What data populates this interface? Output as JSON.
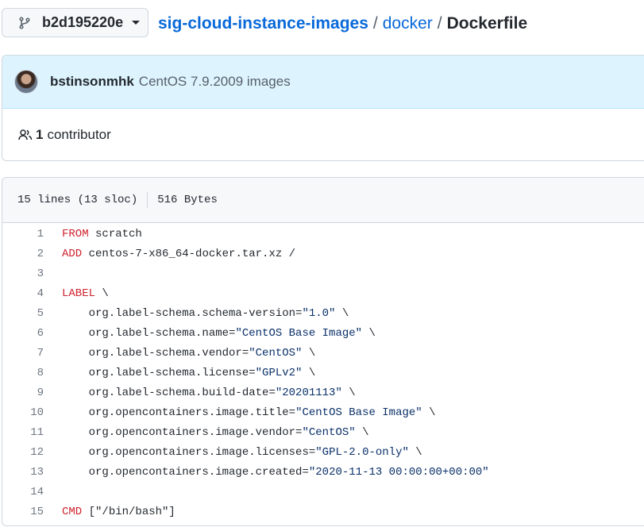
{
  "branch": {
    "name": "b2d195220e"
  },
  "breadcrumb": {
    "repo": "sig-cloud-instance-images",
    "sep1": "/",
    "dir": "docker",
    "sep2": "/",
    "file": "Dockerfile"
  },
  "commit": {
    "author": "bstinsonmhk",
    "message": "CentOS 7.9.2009 images"
  },
  "contributors": {
    "count": "1",
    "label": "contributor"
  },
  "file_info": {
    "lines": "15 lines (13 sloc)",
    "size": "516 Bytes"
  },
  "code": [
    {
      "n": "1",
      "parts": [
        {
          "t": "FROM",
          "c": "kw"
        },
        {
          "t": " scratch",
          "c": ""
        }
      ]
    },
    {
      "n": "2",
      "parts": [
        {
          "t": "ADD",
          "c": "kw"
        },
        {
          "t": " centos-7-x86_64-docker.tar.xz /",
          "c": ""
        }
      ]
    },
    {
      "n": "3",
      "parts": []
    },
    {
      "n": "4",
      "parts": [
        {
          "t": "LABEL",
          "c": "kw"
        },
        {
          "t": " \\",
          "c": ""
        }
      ]
    },
    {
      "n": "5",
      "parts": [
        {
          "t": "    org.label-schema.schema-version=",
          "c": ""
        },
        {
          "t": "\"1.0\"",
          "c": "str"
        },
        {
          "t": " \\",
          "c": ""
        }
      ]
    },
    {
      "n": "6",
      "parts": [
        {
          "t": "    org.label-schema.name=",
          "c": ""
        },
        {
          "t": "\"CentOS Base Image\"",
          "c": "str"
        },
        {
          "t": " \\",
          "c": ""
        }
      ]
    },
    {
      "n": "7",
      "parts": [
        {
          "t": "    org.label-schema.vendor=",
          "c": ""
        },
        {
          "t": "\"CentOS\"",
          "c": "str"
        },
        {
          "t": " \\",
          "c": ""
        }
      ]
    },
    {
      "n": "8",
      "parts": [
        {
          "t": "    org.label-schema.license=",
          "c": ""
        },
        {
          "t": "\"GPLv2\"",
          "c": "str"
        },
        {
          "t": " \\",
          "c": ""
        }
      ]
    },
    {
      "n": "9",
      "parts": [
        {
          "t": "    org.label-schema.build-date=",
          "c": ""
        },
        {
          "t": "\"20201113\"",
          "c": "str"
        },
        {
          "t": " \\",
          "c": ""
        }
      ]
    },
    {
      "n": "10",
      "parts": [
        {
          "t": "    org.opencontainers.image.title=",
          "c": ""
        },
        {
          "t": "\"CentOS Base Image\"",
          "c": "str"
        },
        {
          "t": " \\",
          "c": ""
        }
      ]
    },
    {
      "n": "11",
      "parts": [
        {
          "t": "    org.opencontainers.image.vendor=",
          "c": ""
        },
        {
          "t": "\"CentOS\"",
          "c": "str"
        },
        {
          "t": " \\",
          "c": ""
        }
      ]
    },
    {
      "n": "12",
      "parts": [
        {
          "t": "    org.opencontainers.image.licenses=",
          "c": ""
        },
        {
          "t": "\"GPL-2.0-only\"",
          "c": "str"
        },
        {
          "t": " \\",
          "c": ""
        }
      ]
    },
    {
      "n": "13",
      "parts": [
        {
          "t": "    org.opencontainers.image.created=",
          "c": ""
        },
        {
          "t": "\"2020-11-13 00:00:00+00:00\"",
          "c": "str"
        }
      ]
    },
    {
      "n": "14",
      "parts": []
    },
    {
      "n": "15",
      "parts": [
        {
          "t": "CMD",
          "c": "kw"
        },
        {
          "t": " [\"/bin/bash\"]",
          "c": ""
        }
      ]
    }
  ]
}
